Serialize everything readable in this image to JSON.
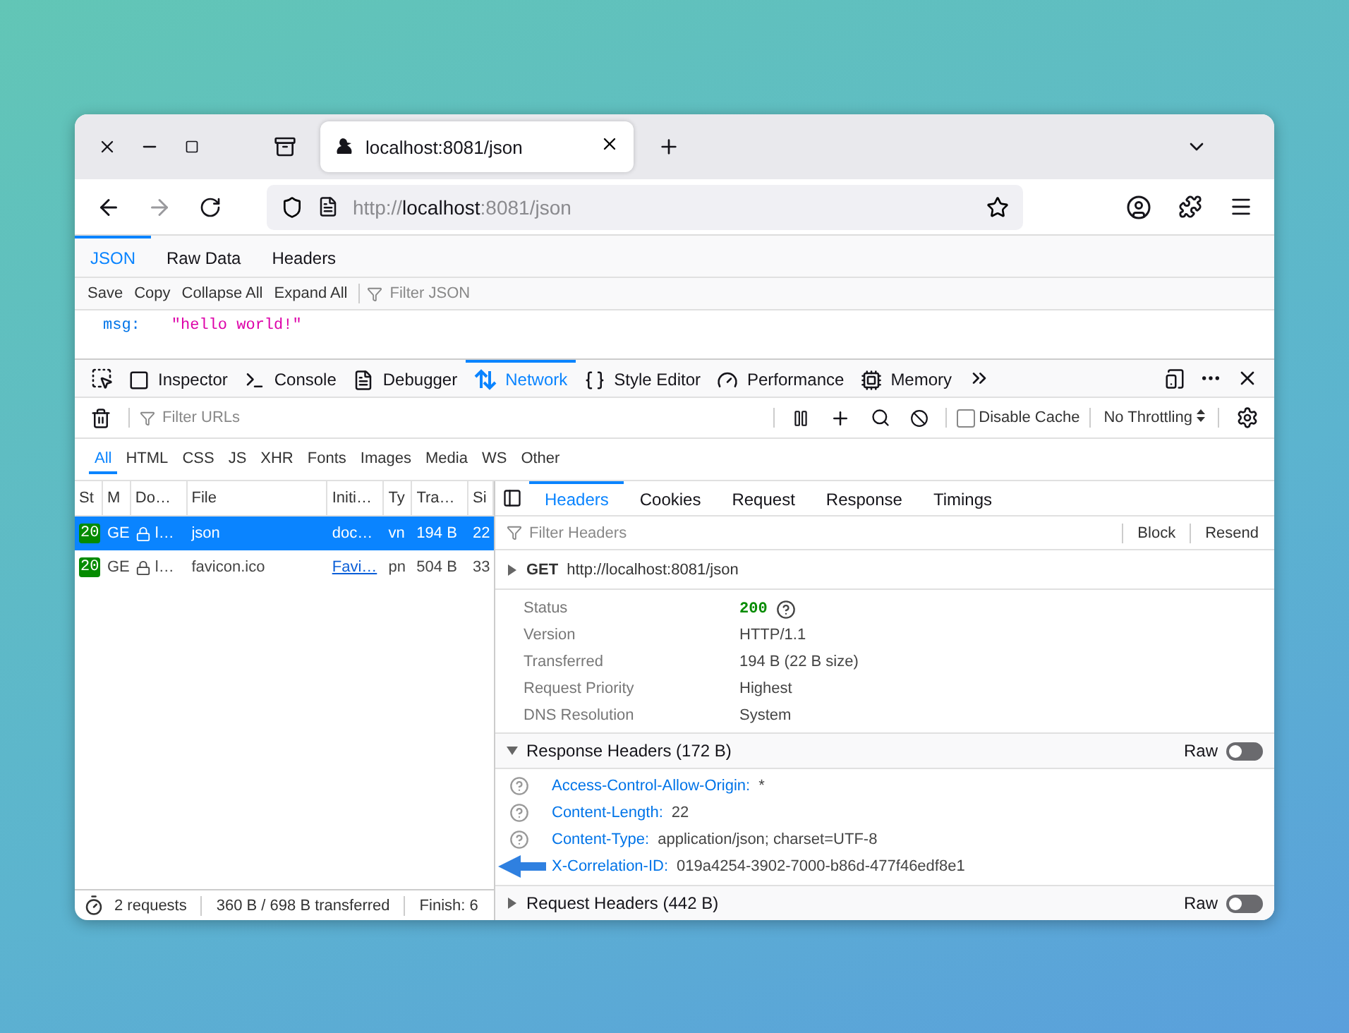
{
  "tab": {
    "title": "localhost:8081/json"
  },
  "url": {
    "scheme": "http://",
    "host": "localhost",
    "rest": ":8081/json"
  },
  "viewer": {
    "tabs": [
      {
        "label": "JSON",
        "selected": true
      },
      {
        "label": "Raw Data",
        "selected": false
      },
      {
        "label": "Headers",
        "selected": false
      }
    ],
    "actions": [
      "Save",
      "Copy",
      "Collapse All",
      "Expand All"
    ],
    "filter_placeholder": "Filter JSON",
    "entries": [
      {
        "key": "msg:",
        "value": "\"hello world!\""
      }
    ]
  },
  "devtools": {
    "tools": [
      {
        "label": "Inspector",
        "selected": false
      },
      {
        "label": "Console",
        "selected": false
      },
      {
        "label": "Debugger",
        "selected": false
      },
      {
        "label": "Network",
        "selected": true
      },
      {
        "label": "Style Editor",
        "selected": false
      },
      {
        "label": "Performance",
        "selected": false
      },
      {
        "label": "Memory",
        "selected": false
      }
    ],
    "filter_placeholder": "Filter URLs",
    "disable_cache": {
      "label": "Disable Cache",
      "checked": false
    },
    "throttling": "No Throttling",
    "types": [
      {
        "label": "All",
        "selected": true
      },
      {
        "label": "HTML",
        "selected": false
      },
      {
        "label": "CSS",
        "selected": false
      },
      {
        "label": "JS",
        "selected": false
      },
      {
        "label": "XHR",
        "selected": false
      },
      {
        "label": "Fonts",
        "selected": false
      },
      {
        "label": "Images",
        "selected": false
      },
      {
        "label": "Media",
        "selected": false
      },
      {
        "label": "WS",
        "selected": false
      },
      {
        "label": "Other",
        "selected": false
      }
    ],
    "columns": [
      "St",
      "M",
      "Do…",
      "File",
      "Initi…",
      "Ty",
      "Tra…",
      "Si"
    ],
    "rows": [
      {
        "selected": true,
        "cells": [
          "20",
          "GE",
          "l…",
          "json",
          "doc…",
          "vn",
          "194 B",
          "22"
        ]
      },
      {
        "selected": false,
        "cells": [
          "20",
          "GE",
          "l…",
          "favicon.ico",
          "Favi…",
          "pn",
          "504 B",
          "33"
        ]
      }
    ],
    "detail_tabs": [
      {
        "label": "Headers",
        "selected": true
      },
      {
        "label": "Cookies",
        "selected": false
      },
      {
        "label": "Request",
        "selected": false
      },
      {
        "label": "Response",
        "selected": false
      },
      {
        "label": "Timings",
        "selected": false
      }
    ],
    "headers_filter_placeholder": "Filter Headers",
    "header_actions": [
      "Block",
      "Resend"
    ],
    "request_line": {
      "method": "GET",
      "url": "http://localhost:8081/json",
      "expanded": false
    },
    "summary": [
      {
        "label": "Status",
        "value": "200",
        "kind": "status"
      },
      {
        "label": "Version",
        "value": "HTTP/1.1",
        "kind": "text"
      },
      {
        "label": "Transferred",
        "value": "194 B (22 B size)",
        "kind": "text"
      },
      {
        "label": "Request Priority",
        "value": "Highest",
        "kind": "text"
      },
      {
        "label": "DNS Resolution",
        "value": "System",
        "kind": "text"
      }
    ],
    "response_headers": {
      "title": "Response Headers (172 B)",
      "expanded": true,
      "raw_label": "Raw",
      "raw_on": false,
      "items": [
        {
          "name": "Access-Control-Allow-Origin:",
          "value": "*",
          "kind": "help"
        },
        {
          "name": "Content-Length:",
          "value": "22",
          "kind": "help"
        },
        {
          "name": "Content-Type:",
          "value": "application/json; charset=UTF-8",
          "kind": "help"
        },
        {
          "name": "X-Correlation-ID:",
          "value": "019a4254-3902-7000-b86d-477f46edf8e1",
          "kind": "arrow"
        }
      ]
    },
    "request_headers": {
      "title": "Request Headers (442 B)",
      "expanded": false,
      "raw_label": "Raw",
      "raw_on": false
    },
    "status_bar": [
      "2 requests",
      "360 B / 698 B transferred",
      "Finish: 6"
    ]
  }
}
